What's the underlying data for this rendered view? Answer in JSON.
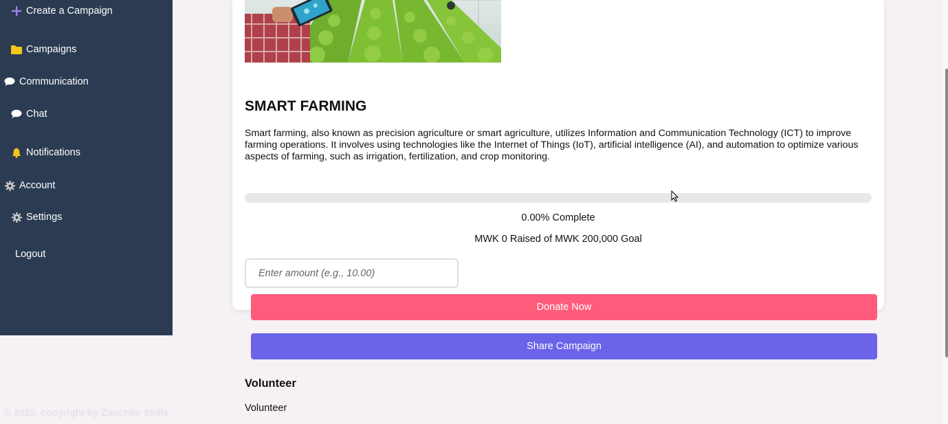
{
  "sidebar": {
    "items": [
      {
        "label": "Create a Campaign",
        "icon": "plus-icon"
      },
      {
        "label": "Campaigns",
        "icon": "folder-icon"
      },
      {
        "label": "Communication",
        "icon": "speech-bubble-icon"
      },
      {
        "label": "Chat",
        "icon": "speech-bubble-icon"
      },
      {
        "label": "Notifications",
        "icon": "bell-icon"
      },
      {
        "label": "Account",
        "icon": "gear-icon"
      },
      {
        "label": "Settings",
        "icon": "gear-icon"
      },
      {
        "label": "Logout",
        "icon": ""
      }
    ]
  },
  "footer": {
    "copyright": "© 2025, copyright by Zanchito Skills"
  },
  "campaign": {
    "title": "SMART FARMING",
    "description": "Smart farming, also known as precision agriculture or smart agriculture, utilizes Information and Communication Technology (ICT) to improve farming operations. It involves using technologies like the Internet of Things (IoT), artificial intelligence (AI), and automation to optimize various aspects of farming, such as irrigation, fertilization, and crop monitoring.",
    "progress_fraction": 0.0,
    "progress_text": "0.00% Complete",
    "raised_text": "MWK 0 Raised of MWK 200,000 Goal",
    "amount_placeholder": "Enter amount (e.g., 10.00)",
    "donate_label": "Donate Now",
    "share_label": "Share Campaign",
    "volunteer_heading": "Volunteer",
    "volunteer_text": "Volunteer"
  },
  "colors": {
    "sidebar_bg": "#2b3b52",
    "donate": "#ff5c7c",
    "share": "#6b63e8",
    "plus_icon": "#a57cf0",
    "folder_icon": "#f5c518",
    "bell_icon": "#f5c518"
  }
}
